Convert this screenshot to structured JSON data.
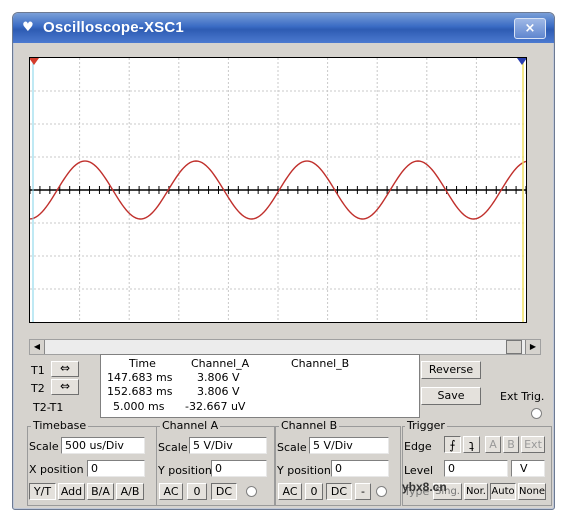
{
  "window": {
    "title": "Oscilloscope-XSC1",
    "close": "×"
  },
  "measurements": {
    "headers": {
      "time": "Time",
      "channel_a": "Channel_A",
      "channel_b": "Channel_B"
    },
    "rows": [
      {
        "label": "T1",
        "time": "147.683 ms",
        "a": "3.806 V",
        "b": ""
      },
      {
        "label": "T2",
        "time": "152.683 ms",
        "a": "3.806 V",
        "b": ""
      },
      {
        "label": "T2-T1",
        "time": "5.000 ms",
        "a": "-32.667 uV",
        "b": ""
      }
    ],
    "reverse": "Reverse",
    "save": "Save",
    "ext_trig": "Ext Trig."
  },
  "timebase": {
    "title": "Timebase",
    "scale_label": "Scale",
    "scale": "500 us/Div",
    "xpos_label": "X position",
    "xpos": "0",
    "modes": [
      "Y/T",
      "Add",
      "B/A",
      "A/B"
    ]
  },
  "channel_a": {
    "title": "Channel A",
    "scale_label": "Scale",
    "scale": "5  V/Div",
    "ypos_label": "Y position",
    "ypos": "0",
    "coupling": [
      "AC",
      "0",
      "DC"
    ]
  },
  "channel_b": {
    "title": "Channel B",
    "scale_label": "Scale",
    "scale": "5  V/Div",
    "ypos_label": "Y position",
    "ypos": "0",
    "coupling": [
      "AC",
      "0",
      "DC",
      "-"
    ]
  },
  "trigger": {
    "title": "Trigger",
    "edge_label": "Edge",
    "sources": [
      "A",
      "B",
      "Ext"
    ],
    "level_label": "Level",
    "level": "0",
    "level_unit": "V",
    "type_label": "Type",
    "modes": [
      "Sing.",
      "Nor.",
      "Auto",
      "None"
    ]
  },
  "watermark": "ybx8.cn",
  "colors": {
    "trace": "#c0302c",
    "title_bar": "#3a6bc4",
    "cursor_t1": "#d23c2c",
    "cursor_t2": "#2a3fb0"
  },
  "icons": {
    "title": "oscilloscope-icon",
    "t1_arrows": "left-right-arrows-icon",
    "t2_arrows": "left-right-arrows-icon"
  }
}
